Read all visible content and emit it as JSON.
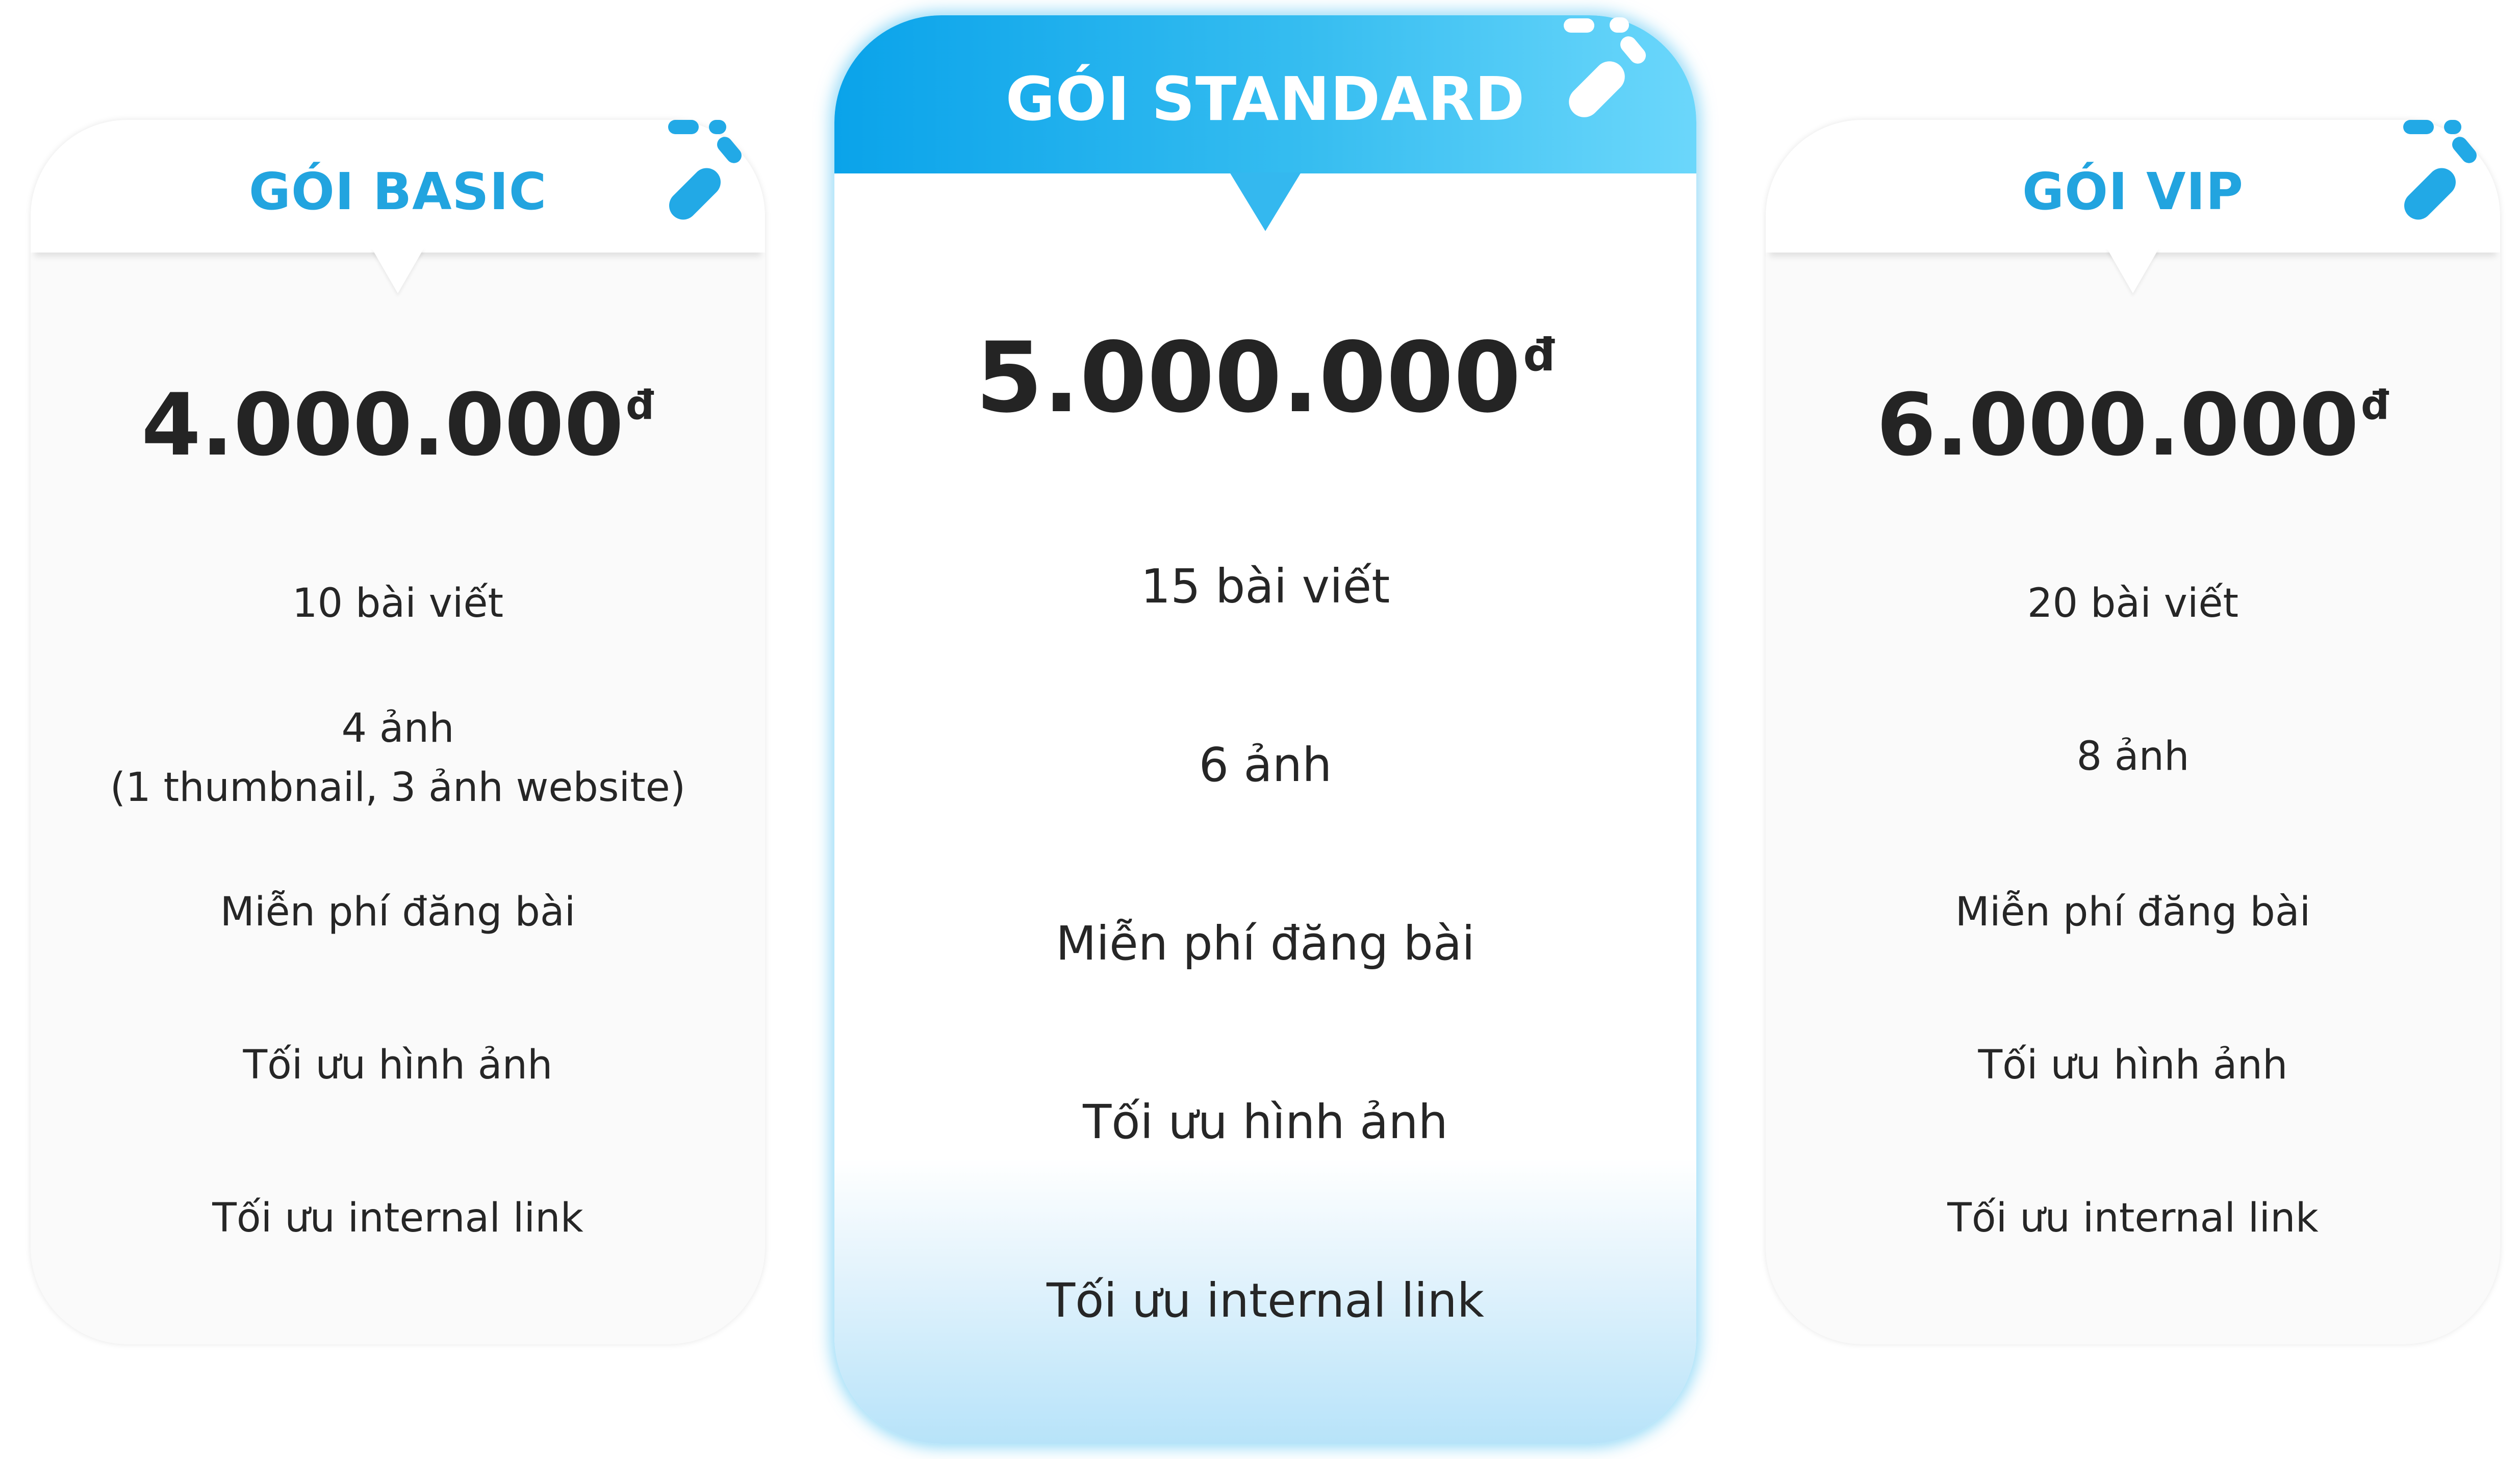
{
  "plans": [
    {
      "name": "GÓI BASIC",
      "price": "4.000.000",
      "currency": "đ",
      "features": [
        "10 bài viết",
        "4 ảnh",
        "(1 thumbnail, 3 ảnh website)",
        "Miễn phí đăng bài",
        "Tối ưu hình ảnh",
        "Tối ưu internal link"
      ]
    },
    {
      "name": "GÓI STANDARD",
      "price": "5.000.000",
      "currency": "đ",
      "features": [
        "15 bài viết",
        "6 ảnh",
        "Miễn phí đăng bài",
        "Tối ưu hình ảnh",
        "Tối ưu internal link"
      ]
    },
    {
      "name": "GÓI VIP",
      "price": "6.000.000",
      "currency": "đ",
      "features": [
        "20 bài viết",
        "8 ảnh",
        "Miễn phí đăng bài",
        "Tối ưu hình ảnh",
        "Tối ưu internal link"
      ]
    }
  ],
  "colors": {
    "accent": "#22a4df",
    "featured_header_start": "#0aa3ea",
    "featured_header_end": "#6bd7fb",
    "price_text": "#242424",
    "card_bg": "#fafafa"
  },
  "icons": {
    "header_decoration": "confetti-dots-icon"
  }
}
